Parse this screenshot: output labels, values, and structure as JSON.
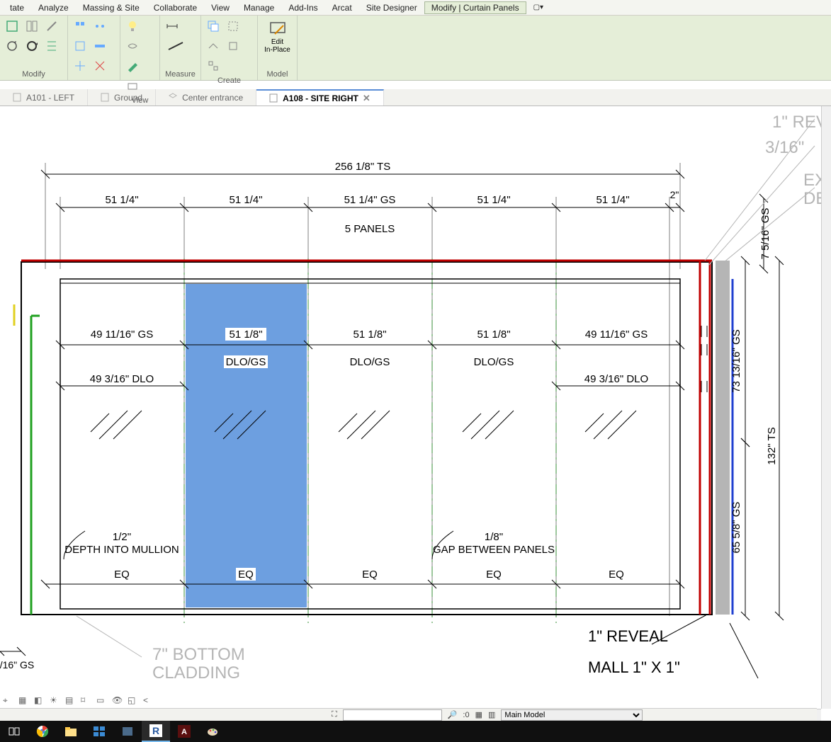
{
  "menubar": {
    "items": [
      "tate",
      "Analyze",
      "Massing & Site",
      "Collaborate",
      "View",
      "Manage",
      "Add-Ins",
      "Arcat",
      "Site Designer",
      "Modify | Curtain Panels"
    ],
    "active_index": 9
  },
  "ribbon": {
    "groups": [
      {
        "label": "Modify"
      },
      {
        "label": ""
      },
      {
        "label": "View"
      },
      {
        "label": "Measure"
      },
      {
        "label": "Create"
      },
      {
        "label": "Model",
        "big_button": "Edit\nIn-Place"
      }
    ]
  },
  "doc_tabs": {
    "tabs": [
      {
        "label": "A101 - LEFT"
      },
      {
        "label": "Ground"
      },
      {
        "label": "Center entrance"
      },
      {
        "label": "A108 - SITE RIGHT",
        "active": true
      }
    ]
  },
  "drawing": {
    "dims_top": {
      "overall": "256 1/8\" TS",
      "panels": [
        "51 1/4\"",
        "51 1/4\"",
        "51 1/4\" GS",
        "51 1/4\"",
        "51 1/4\""
      ],
      "end": "2\"",
      "note": "5 PANELS"
    },
    "dims_mid": {
      "row1": [
        "49 11/16\" GS",
        "51 1/8\"",
        "51 1/8\"",
        "51 1/8\"",
        "49 11/16\" GS"
      ],
      "row2": [
        "49 3/16\" DLO",
        "DLO/GS",
        "DLO/GS",
        "DLO/GS",
        "49 3/16\" DLO"
      ]
    },
    "dims_bottom": {
      "eq": [
        "EQ",
        "EQ",
        "EQ",
        "EQ",
        "EQ"
      ]
    },
    "notes": {
      "depth_top": "1/2\"",
      "depth": "DEPTH INTO MULLION",
      "gap_top": "1/8\"",
      "gap": "GAP BETWEEN PANELS",
      "reveal_top_1": "1\" REV",
      "reveal_top_2": "3/16\"",
      "ex": "EX",
      "de": "DE",
      "reveal_bottom": "1\" REVEAL",
      "mall": "MALL 1\" X 1\"",
      "bottom_cladding_1": "7\" BOTTOM",
      "bottom_cladding_2": "CLADDING",
      "left_gs": "/16\" GS"
    },
    "dims_right": {
      "v1": "7 5/16\" GS",
      "v2": "73 13/16\" GS",
      "v3": "132\" TS",
      "v4": "65 5/8\" GS"
    }
  },
  "status": {
    "scale_label": ":0",
    "model_select": "Main Model"
  }
}
